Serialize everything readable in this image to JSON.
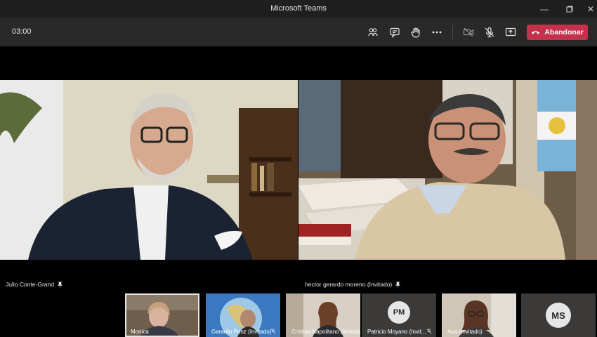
{
  "window": {
    "title": "Microsoft Teams"
  },
  "toolbar": {
    "timer": "03:00",
    "leave_label": "Abandonar",
    "icons": [
      "participants-icon",
      "chat-icon",
      "raise-hand-icon",
      "more-icon",
      "camera-off-icon",
      "mic-off-icon",
      "share-screen-icon",
      "phone-hangup-icon"
    ]
  },
  "videos": [
    {
      "name": "Julio Conte-Grand"
    },
    {
      "name": "hector gerardo moreno (Invitado)"
    }
  ],
  "tiles": [
    {
      "name": "Monica",
      "initials": "",
      "selected": true
    },
    {
      "name": "Gerardo Ponz (Invitado)",
      "initials": ""
    },
    {
      "name": "Cristina Napolitano (Invitado)",
      "initials": ""
    },
    {
      "name": "Patricio Moyano (Invit...",
      "initials": "PM"
    },
    {
      "name": "Ana (Invitado)",
      "initials": ""
    },
    {
      "name": "",
      "initials": "MS"
    }
  ],
  "colors": {
    "leave": "#c4314b",
    "toolbar": "#292929",
    "titlebar": "#1f1f1f"
  }
}
